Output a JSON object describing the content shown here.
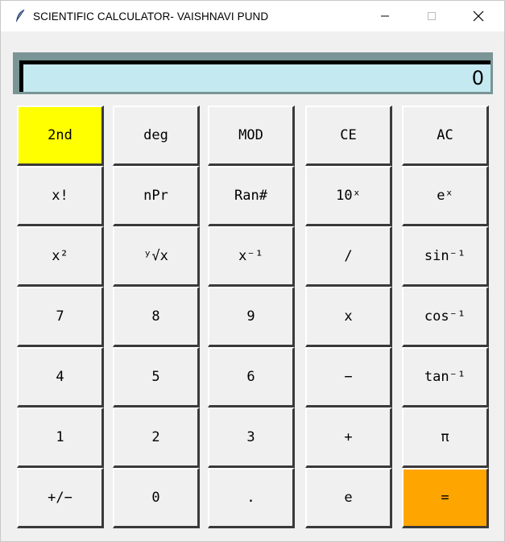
{
  "window": {
    "title": "SCIENTIFIC CALCULATOR- VAISHNAVI PUND",
    "icon": "feather-icon",
    "controls": {
      "minimize": "minimize-icon",
      "maximize": "maximize-icon",
      "close": "close-icon"
    }
  },
  "display": {
    "value": "0",
    "background": "#c5e9f1"
  },
  "buttons": [
    [
      "2nd",
      "deg",
      "MOD",
      "CE",
      "AC"
    ],
    [
      "x!",
      "nPr",
      "Ran#",
      "10ˣ",
      "eˣ"
    ],
    [
      "x²",
      "ʸ√x",
      "x⁻¹",
      "/",
      "sin⁻¹"
    ],
    [
      "7",
      "8",
      "9",
      "x",
      "cos⁻¹"
    ],
    [
      "4",
      "5",
      "6",
      "−",
      "tan⁻¹"
    ],
    [
      "1",
      "2",
      "3",
      "+",
      "π"
    ],
    [
      "+/−",
      "0",
      ".",
      "e",
      "="
    ]
  ],
  "colors": {
    "second": "#ffff00",
    "equals": "#ffa500",
    "button": "#f0f0f0"
  }
}
